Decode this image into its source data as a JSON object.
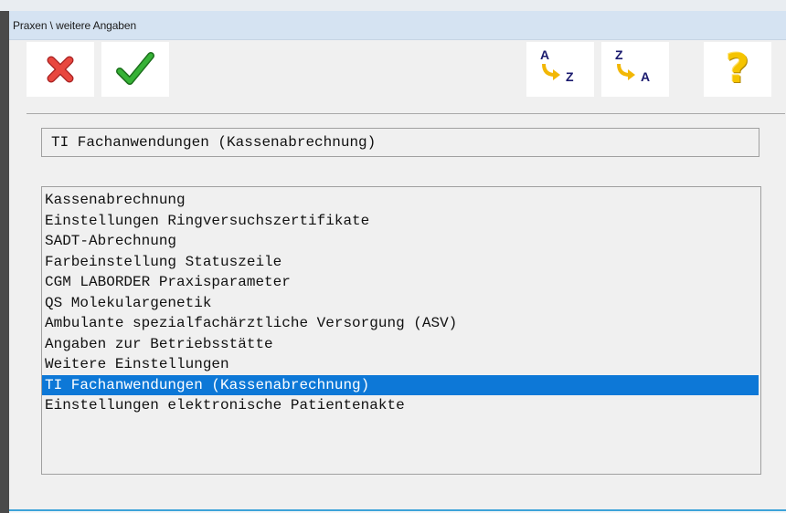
{
  "window": {
    "title": "Praxen \\ weitere Angaben"
  },
  "toolbar": {
    "cancel_icon": "red-x-icon",
    "ok_icon": "green-checkmark-icon",
    "sort_az": {
      "icon": "sort-az-icon",
      "top_letter": "A",
      "bottom_letter": "Z"
    },
    "sort_za": {
      "icon": "sort-za-icon",
      "top_letter": "Z",
      "bottom_letter": "A"
    },
    "help": {
      "icon": "question-mark-icon",
      "glyph": "?"
    }
  },
  "selected_field": {
    "value": "TI Fachanwendungen (Kassenabrechnung)"
  },
  "list": {
    "items": [
      "Kassenabrechnung",
      "Einstellungen Ringversuchszertifikate",
      "SADT-Abrechnung",
      "Farbeinstellung Statuszeile",
      "CGM LABORDER Praxisparameter",
      "QS Molekulargenetik",
      "Ambulante spezialfachärztliche Versorgung (ASV)",
      "Angaben zur Betriebsstätte",
      "Weitere Einstellungen",
      "TI Fachanwendungen (Kassenabrechnung)",
      "Einstellungen elektronische Patientenakte"
    ],
    "selected_index": 9
  },
  "colors": {
    "selection": "#0d78d7",
    "cancel_red": "#e03c3c",
    "ok_green": "#2e9d2e",
    "sort_arrow": "#f2b705",
    "help_yellow": "#f5c400"
  }
}
